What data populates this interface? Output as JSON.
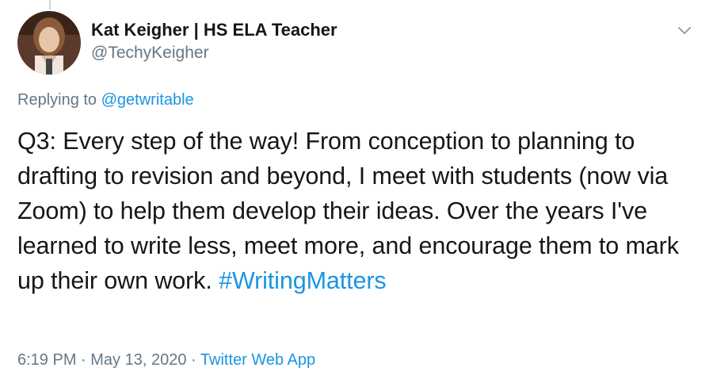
{
  "author": {
    "display_name": "Kat Keigher | HS ELA Teacher",
    "handle": "@TechyKeigher"
  },
  "reply": {
    "prefix": "Replying to ",
    "mention": "@getwritable"
  },
  "tweet": {
    "text": "Q3: Every step of the way! From conception to planning to drafting to revision and beyond, I meet with students (now via Zoom) to help them develop their ideas. Over the years I've learned to write less, meet more, and encourage them to mark up their own work.",
    "hashtag": "#WritingMatters"
  },
  "meta": {
    "time": "6:19 PM",
    "separator": " · ",
    "date": "May 13, 2020",
    "source": "Twitter Web App"
  },
  "icons": {
    "caret": "chevron-down-icon",
    "avatar": "avatar"
  },
  "colors": {
    "link": "#1b95e0",
    "secondary_text": "#657786",
    "primary_text": "#14171a",
    "thread_line": "#ccd6dd"
  }
}
